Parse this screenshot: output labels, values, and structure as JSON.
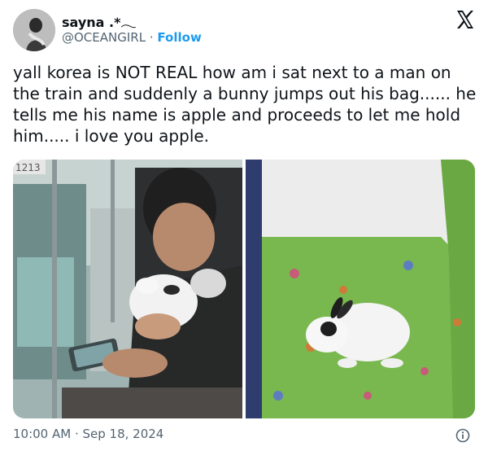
{
  "author": {
    "display_name": "sayna .*𓂃",
    "handle": "@OCEANGIRL",
    "separator": "·",
    "follow_label": "Follow"
  },
  "tweet": {
    "text": "yall korea is NOT REAL how am i sat next to a man on the train and suddenly a bunny jumps out his bag...... he tells me his name is apple and proceeds to let me hold him..... i love you apple."
  },
  "media": {
    "photo1_sign": "1213"
  },
  "footer": {
    "timestamp": "10:00 AM · Sep 18, 2024"
  },
  "icons": {
    "platform": "x-logo-icon",
    "info": "info-icon"
  }
}
